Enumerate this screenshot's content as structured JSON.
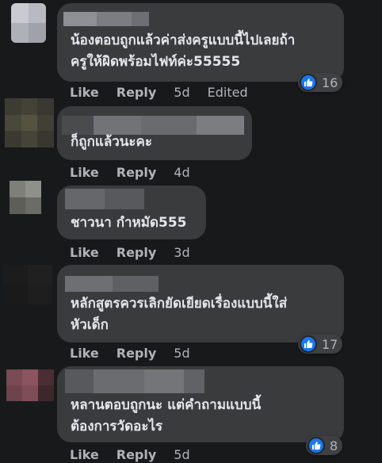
{
  "comments": [
    {
      "text": "น้องตอบถูกแล้วค่าส่งครูแบบนี้ไปเลยถ้า\nครูให้ผิดพร้อมไฟท์ค่ะ55555",
      "like": "Like",
      "reply": "Reply",
      "time": "5d",
      "edited": "Edited",
      "reactions": "16"
    },
    {
      "text": "ก็ถูกแล้วนะคะ",
      "like": "Like",
      "reply": "Reply",
      "time": "4d"
    },
    {
      "text": "ชาวนา กำหมัด555",
      "like": "Like",
      "reply": "Reply",
      "time": "3d"
    },
    {
      "text": "หลักสูตรควรเลิกยัดเยียดเรื่องแบบนี้ใส่\nหัวเด็ก",
      "like": "Like",
      "reply": "Reply",
      "time": "5d",
      "reactions": "17"
    },
    {
      "text": "หลานตอบถูกนะ แต่คำถามแบบนี้\nต้องการวัดอะไร",
      "like": "Like",
      "reply": "Reply",
      "time": "5d",
      "reactions": "8"
    }
  ],
  "colors": {
    "background": "#18191a",
    "bubble": "#3a3b3c",
    "like_blue": "#1877f2",
    "muted_text": "#b0b3b8"
  }
}
